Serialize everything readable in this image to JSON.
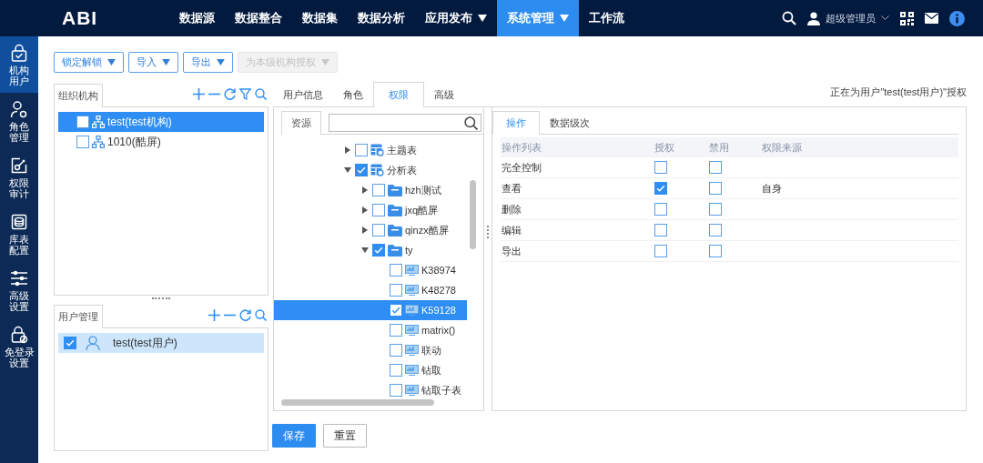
{
  "topbar": {
    "logo": "ABI",
    "nav": [
      {
        "label": "数据源",
        "selected": false,
        "menu": false
      },
      {
        "label": "数据整合",
        "selected": false,
        "menu": false
      },
      {
        "label": "数据集",
        "selected": false,
        "menu": false
      },
      {
        "label": "数据分析",
        "selected": false,
        "menu": false
      },
      {
        "label": "应用发布",
        "selected": false,
        "menu": true
      },
      {
        "label": "系统管理",
        "selected": true,
        "menu": true
      },
      {
        "label": "工作流",
        "selected": false,
        "menu": false
      }
    ],
    "user": "超级管理员"
  },
  "sidebar": [
    {
      "kind": "lock",
      "lines": [
        "机构",
        "用户"
      ],
      "selected": true
    },
    {
      "kind": "roles",
      "lines": [
        "角色",
        "管理"
      ],
      "selected": false
    },
    {
      "kind": "audit",
      "lines": [
        "权限",
        "审计"
      ],
      "selected": false
    },
    {
      "kind": "database",
      "lines": [
        "库表",
        "配置"
      ],
      "selected": false
    },
    {
      "kind": "sliders",
      "lines": [
        "高级",
        "设置"
      ],
      "selected": false
    },
    {
      "kind": "nologin",
      "lines": [
        "免登录",
        "设置"
      ],
      "selected": false
    }
  ],
  "toolbar": [
    {
      "label": "锁定解锁",
      "disabled": false
    },
    {
      "label": "导入",
      "disabled": false
    },
    {
      "label": "导出",
      "disabled": false
    },
    {
      "label": "为本级机构授权",
      "disabled": true
    }
  ],
  "org_panel": {
    "title": "组织机构",
    "items": [
      {
        "label": "test(test机构)",
        "selected": true,
        "checked": false
      },
      {
        "label": "1010(酷屏)",
        "selected": false,
        "checked": false
      }
    ]
  },
  "user_panel": {
    "title": "用户管理",
    "items": [
      {
        "label": "test(test用户)",
        "selected": true,
        "checked": true
      }
    ]
  },
  "tabs": [
    {
      "label": "用户信息",
      "selected": false
    },
    {
      "label": "角色",
      "selected": false
    },
    {
      "label": "权限",
      "selected": true
    },
    {
      "label": "高级",
      "selected": false
    }
  ],
  "notice": "正在为用户\"test(test用户)\"授权",
  "resource_panel": {
    "tab": "资源",
    "tree": [
      {
        "label": "主题表",
        "kind": "table",
        "checked": false,
        "selected": false,
        "expanded": false
      },
      {
        "label": "分析表",
        "kind": "table",
        "checked": true,
        "selected": false,
        "expanded": true,
        "children": [
          {
            "label": "hzh测试",
            "kind": "folder",
            "checked": false,
            "selected": false,
            "expanded": false
          },
          {
            "label": "jxq酷屏",
            "kind": "folder",
            "checked": false,
            "selected": false,
            "expanded": false
          },
          {
            "label": "qinzx酷屏",
            "kind": "folder",
            "checked": false,
            "selected": false,
            "expanded": false
          },
          {
            "label": "ty",
            "kind": "folder",
            "checked": true,
            "selected": false,
            "expanded": true,
            "children": [
              {
                "label": "K38974",
                "kind": "report",
                "checked": false,
                "selected": false
              },
              {
                "label": "K48278",
                "kind": "report",
                "checked": false,
                "selected": false
              },
              {
                "label": "K59128",
                "kind": "report",
                "checked": true,
                "selected": true
              },
              {
                "label": "matrix()",
                "kind": "report",
                "checked": false,
                "selected": false
              },
              {
                "label": "联动",
                "kind": "report",
                "checked": false,
                "selected": false
              },
              {
                "label": "钻取",
                "kind": "report",
                "checked": false,
                "selected": false
              },
              {
                "label": "钻取子表",
                "kind": "report",
                "checked": false,
                "selected": false
              }
            ]
          }
        ]
      }
    ]
  },
  "ops_panel": {
    "tabs": [
      {
        "label": "操作",
        "selected": true
      },
      {
        "label": "数据级次",
        "selected": false
      }
    ],
    "columns": [
      "操作列表",
      "授权",
      "禁用",
      "权限来源"
    ],
    "rows": [
      {
        "name": "完全控制",
        "grant": false,
        "deny": false
      },
      {
        "name": "查看",
        "grant": true,
        "deny": false,
        "source": "自身"
      },
      {
        "name": "删除",
        "grant": false,
        "deny": false
      },
      {
        "name": "编辑",
        "grant": false,
        "deny": false
      },
      {
        "name": "导出",
        "grant": false,
        "deny": false
      }
    ]
  },
  "actions": [
    {
      "label": "保存",
      "kind": "primary"
    },
    {
      "label": "重置",
      "kind": "default"
    }
  ]
}
